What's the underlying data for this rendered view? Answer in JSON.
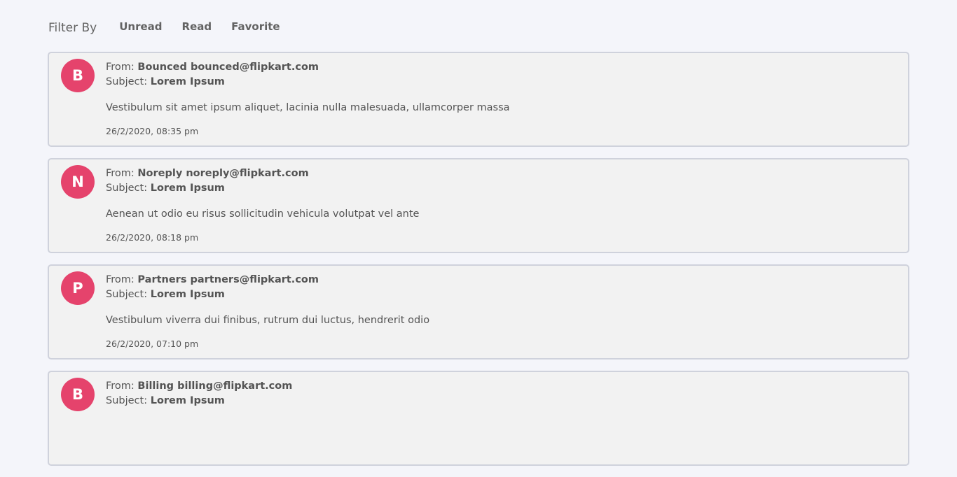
{
  "filter": {
    "label": "Filter By",
    "options": [
      "Unread",
      "Read",
      "Favorite"
    ]
  },
  "colors": {
    "avatar_bg": "#e5436c",
    "card_bg": "#f2f2f2",
    "card_border": "#cfd2dc",
    "page_bg": "#f4f5fa"
  },
  "labels": {
    "from": "From: ",
    "subject": "Subject: "
  },
  "emails": [
    {
      "initial": "B",
      "from": "Bounced bounced@flipkart.com",
      "subject": "Lorem Ipsum",
      "body": "Vestibulum sit amet ipsum aliquet, lacinia nulla malesuada, ullamcorper massa",
      "time": "26/2/2020, 08:35 pm"
    },
    {
      "initial": "N",
      "from": "Noreply noreply@flipkart.com",
      "subject": "Lorem Ipsum",
      "body": "Aenean ut odio eu risus sollicitudin vehicula volutpat vel ante",
      "time": "26/2/2020, 08:18 pm"
    },
    {
      "initial": "P",
      "from": "Partners partners@flipkart.com",
      "subject": "Lorem Ipsum",
      "body": "Vestibulum viverra dui finibus, rutrum dui luctus, hendrerit odio",
      "time": "26/2/2020, 07:10 pm"
    },
    {
      "initial": "B",
      "from": "Billing billing@flipkart.com",
      "subject": "Lorem Ipsum"
    }
  ]
}
